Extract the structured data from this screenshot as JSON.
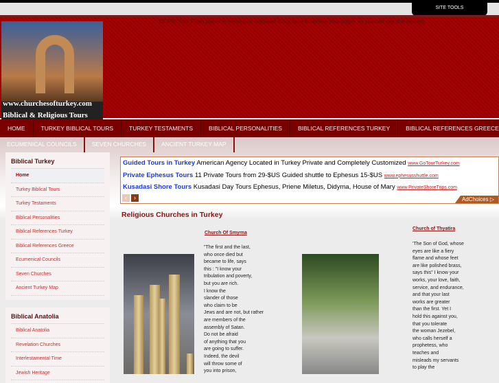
{
  "top": {
    "site_tools": "SITE TOOLS",
    "flash_msg_1": "OOPS. Your Flash player is missing or outdated.",
    "flash_link": "Click here",
    "flash_msg_2": "to update your player so you can see this content."
  },
  "logo": {
    "line1": "www.churchesofturkey.com",
    "line2": "Biblical & Religious Tours"
  },
  "nav_main": [
    "HOME",
    "TURKEY BIBLICAL TOURS",
    "TURKEY TESTAMENTS",
    "BIBLICAL PERSONALITIES",
    "BIBLICAL REFERENCES TURKEY",
    "BIBLICAL REFERENCES GREECE"
  ],
  "nav_sub": [
    "ECUMENICAL COUNCILS",
    "SEVEN CHURCHES",
    "ANCIENT TURKEY MAP"
  ],
  "sidebar": {
    "box1": {
      "title": "Biblical Turkey",
      "items": [
        "Home",
        "Turkey Biblical Tours",
        "Turkey Testaments",
        "Biblical Personalities",
        "Biblical References Turkey",
        "Biblical References Greece",
        "Ecumenical Councils",
        "Seven Churches",
        "Ancient Turkey Map"
      ]
    },
    "box2": {
      "title": "Biblical Anatolia",
      "items": [
        "Biblical Anatolia",
        "Revelation Churches",
        "Interlestamental Time",
        "Jewish Heritage"
      ]
    }
  },
  "ads": [
    {
      "title": "Guided Tours in Turkey",
      "text": "American Agency Located in Turkey Private and Completely Customized",
      "url": "www.GoTourTurkey.com"
    },
    {
      "title": "Private Ephesus Tours",
      "text": "11 Private Tours from 29-$US Guided shuttle to Ephesus 15-$US",
      "url": "www.ephesusshuttle.com"
    },
    {
      "title": "Kusadasi Shore Tours",
      "text": "Kusadasi Day Tours Ephesus, Priene Miletus, Didyma, House of Mary",
      "url": "www.PrivateShoreTrips.com"
    }
  ],
  "adchoices": "AdChoices ▷",
  "main": {
    "heading": "Religious Churches in Turkey",
    "smyrna": {
      "title": "Church Of Smyrna",
      "text": "\"The first and the last,\nwho once died but\nbecame to life, says\nthis : \"I know your\ntribulation and poverty,\nbut you are rich.\nI know the\nslander of those\nwho claim to be\nJews and are not, but rather\nare members of the\nassembly of Satan.\nDo not be afraid\nof anything that you\nare going to suffer.\nIndeed, the devil\nwill throw some of\nyou into prison,"
    },
    "thyatira": {
      "title": "Church of Thyatira",
      "text": "'The Son of God, whose\neyes are like a fiery\nflame and whose feet\nare like polished brass,\nsays this\" I know your\nworks, your love, faith,\nservice, and endurance,\nand that your last\nworks are greater\nthan the first. Yet I\nhold this against you,\nthat you tolerate\nthe woman Jezebel,\nwho calls herself a\nprophetess, who\nteaches and\nmisleads my servants\nto play the"
    }
  }
}
